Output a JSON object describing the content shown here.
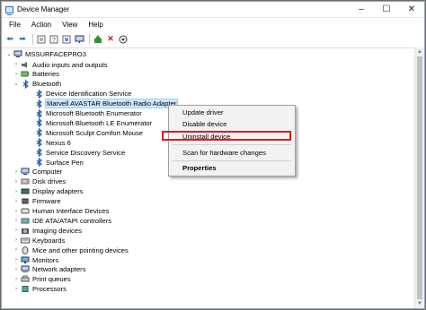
{
  "window": {
    "title": "Device Manager"
  },
  "menubar": [
    "File",
    "Action",
    "View",
    "Help"
  ],
  "toolbar": {
    "buttons": [
      "back-icon",
      "forward-icon",
      "properties-icon",
      "help-icon",
      "details-icon",
      "monitor-icon",
      "update-driver-icon",
      "remove-icon",
      "download-icon"
    ]
  },
  "tree": {
    "root": "MSSURFACEPRO3",
    "items": [
      {
        "label": "Audio inputs and outputs",
        "icon": "speaker-icon"
      },
      {
        "label": "Batteries",
        "icon": "battery-icon"
      },
      {
        "label": "Bluetooth",
        "icon": "bluetooth-icon"
      },
      {
        "label": "Device Identification Service",
        "icon": "bluetooth-icon"
      },
      {
        "label": "Marvell AVASTAR Bluetooth Radio Adapter",
        "icon": "bluetooth-icon"
      },
      {
        "label": "Microsoft Bluetooth Enumerator",
        "icon": "bluetooth-icon"
      },
      {
        "label": "Microsoft Bluetooth LE Enumerator",
        "icon": "bluetooth-icon"
      },
      {
        "label": "Microsoft Sculpt Comfort Mouse",
        "icon": "bluetooth-icon"
      },
      {
        "label": "Nexus 6",
        "icon": "bluetooth-icon"
      },
      {
        "label": "Service Discovery Service",
        "icon": "bluetooth-icon"
      },
      {
        "label": "Surface Pen",
        "icon": "bluetooth-icon"
      },
      {
        "label": "Computer",
        "icon": "computer-icon"
      },
      {
        "label": "Disk drives",
        "icon": "disk-icon"
      },
      {
        "label": "Display adapters",
        "icon": "display-icon"
      },
      {
        "label": "Firmware",
        "icon": "firmware-icon"
      },
      {
        "label": "Human Interface Devices",
        "icon": "hid-icon"
      },
      {
        "label": "IDE ATA/ATAPI controllers",
        "icon": "ide-icon"
      },
      {
        "label": "Imaging devices",
        "icon": "camera-icon"
      },
      {
        "label": "Keyboards",
        "icon": "keyboard-icon"
      },
      {
        "label": "Mice and other pointing devices",
        "icon": "mouse-icon"
      },
      {
        "label": "Monitors",
        "icon": "monitor-icon"
      },
      {
        "label": "Network adapters",
        "icon": "network-icon"
      },
      {
        "label": "Print queues",
        "icon": "printer-icon"
      },
      {
        "label": "Processors",
        "icon": "processor-icon"
      }
    ]
  },
  "context_menu": {
    "update": "Update driver",
    "disable": "Disable device",
    "uninstall": "Uninstall device",
    "scan": "Scan for hardware changes",
    "properties": "Properties"
  },
  "colors": {
    "highlight": "#d32020",
    "selection": "#cce8ff",
    "bluetooth": "#1f5fa8"
  }
}
